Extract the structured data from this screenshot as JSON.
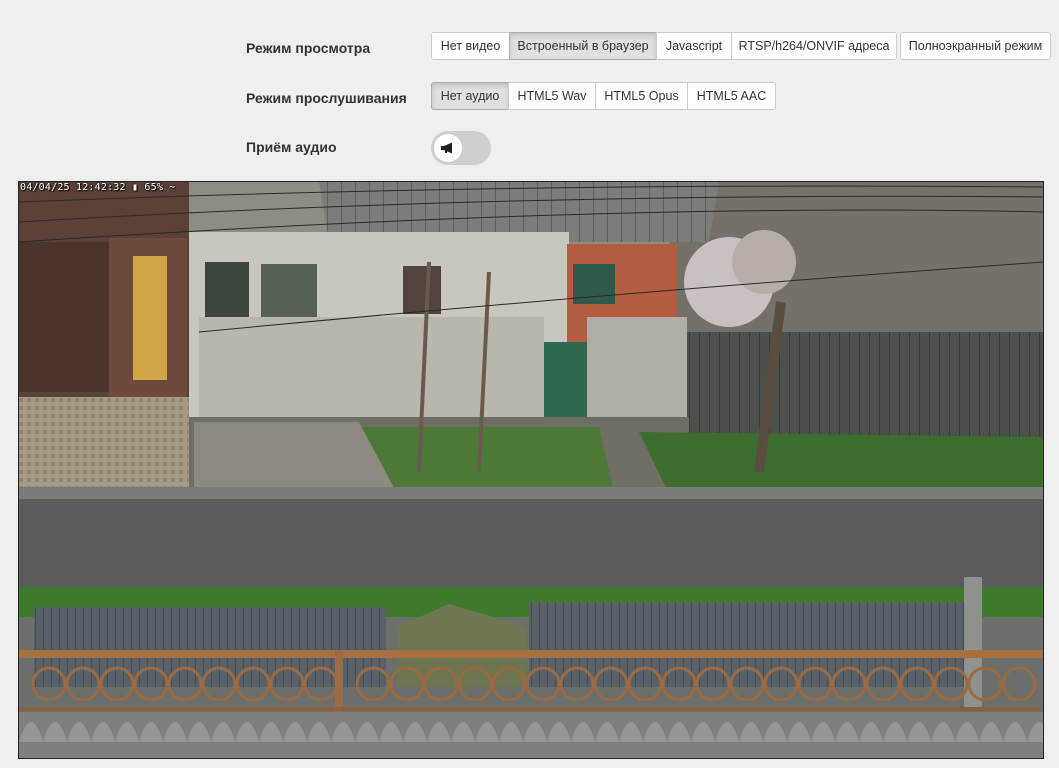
{
  "view_mode": {
    "label": "Режим просмотра",
    "buttons": [
      "Нет видео",
      "Встроенный в браузер",
      "Javascript",
      "RTSP/h264/ONVIF адреса"
    ],
    "active_index": 1,
    "fullscreen_label": "Полноэкранный режим"
  },
  "listen_mode": {
    "label": "Режим прослушивания",
    "buttons": [
      "Нет аудио",
      "HTML5 Wav",
      "HTML5 Opus",
      "HTML5 AAC"
    ],
    "active_index": 0
  },
  "audio_receive": {
    "label": "Приём аудио",
    "toggle_on": false,
    "icon": "megaphone-icon"
  },
  "video": {
    "osd_text": "04/04/25 12:42:32 ▮ 65% ∼"
  },
  "colors": {
    "active_button": "#e0e0e0",
    "toggle_off": "#cfcfcf",
    "page_bg": "#efefef"
  }
}
